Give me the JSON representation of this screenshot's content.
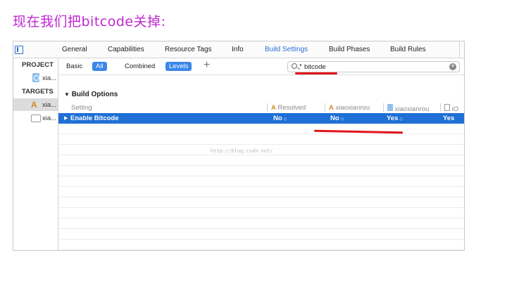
{
  "heading": "现在我们把bitcode关掉:",
  "tabs": [
    {
      "label": "General"
    },
    {
      "label": "Capabilities"
    },
    {
      "label": "Resource Tags"
    },
    {
      "label": "Info"
    },
    {
      "label": "Build Settings",
      "active": true
    },
    {
      "label": "Build Phases"
    },
    {
      "label": "Build Rules"
    }
  ],
  "sidebar": {
    "project_header": "PROJECT",
    "project_item": "xia...",
    "targets_header": "TARGETS",
    "target_items": [
      "xia...",
      "xia..."
    ]
  },
  "filters": {
    "basic": "Basic",
    "all": "All",
    "combined": "Combined",
    "levels": "Levels",
    "add": "+"
  },
  "search": {
    "value": "bitcode",
    "clear": "✕"
  },
  "section": {
    "title": "Build Options"
  },
  "columns": {
    "setting": "Setting",
    "resolved": "Resolved",
    "target": "xiaoxianrou",
    "project": "xiaoxianrou",
    "ios_default": "iO"
  },
  "row": {
    "name": "Enable Bitcode",
    "resolved": "No",
    "target": "No",
    "project": "Yes",
    "ios_default": "Yes",
    "stepper": "◇"
  },
  "watermark": "http://blog.csdn.net/",
  "colors": {
    "accent": "#2b6fd6",
    "selected_row": "#1f6fd6",
    "annotation": "#e0141c",
    "heading": "#c026d3"
  }
}
